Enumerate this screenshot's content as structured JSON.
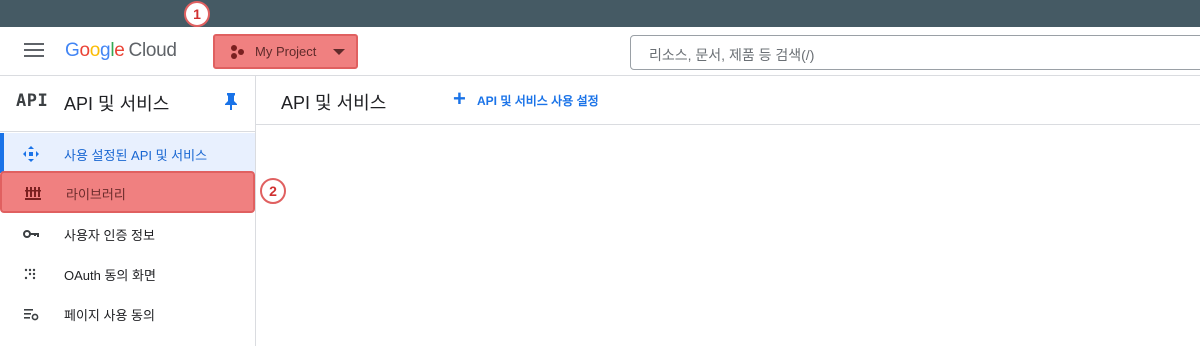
{
  "header": {
    "logo_google": [
      "G",
      "o",
      "o",
      "g",
      "l",
      "e"
    ],
    "logo_cloud": "Cloud",
    "project_label": "My Project",
    "search_placeholder": "리소스, 문서, 제품 등 검색(/)"
  },
  "annotations": {
    "badge1": "1",
    "badge2": "2"
  },
  "sidebar": {
    "api_glyph": "API",
    "title": "API 및 서비스",
    "items": [
      {
        "label": "사용 설정된 API 및 서비스",
        "icon": "diamond-nodes-icon",
        "active": true
      },
      {
        "label": "라이브러리",
        "icon": "library-icon",
        "highlighted": true
      },
      {
        "label": "사용자 인증 정보",
        "icon": "key-icon"
      },
      {
        "label": "OAuth 동의 화면",
        "icon": "dots-grid-icon"
      },
      {
        "label": "페이지 사용 동의",
        "icon": "settings-list-icon"
      }
    ]
  },
  "main": {
    "title": "API 및 서비스",
    "enable_label": "API 및 서비스 사용 설정"
  },
  "colors": {
    "top_strip": "#455a64",
    "accent_blue": "#1a73e8",
    "highlight": "#f08080"
  }
}
